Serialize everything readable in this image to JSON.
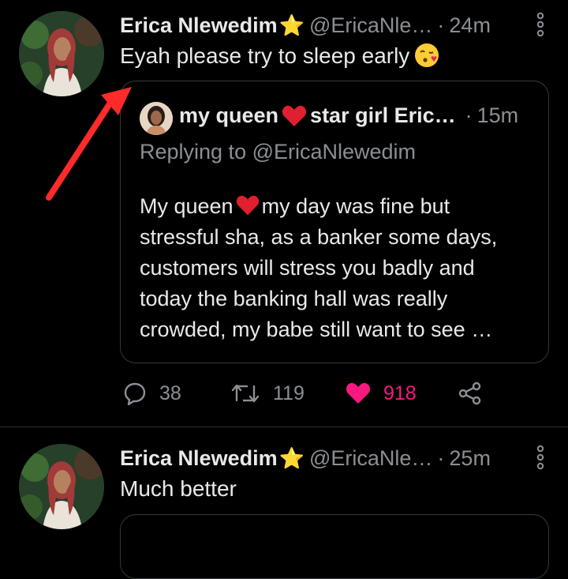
{
  "tweets": [
    {
      "author_name": "Erica Nlewedim",
      "star": "⭐",
      "handle": "@EricaNle…",
      "separator": "·",
      "time": "24m",
      "text": "Eyah please try to sleep early",
      "emoji_icon": "face-blowing-kiss-emoji",
      "quote": {
        "author_name": "my queen",
        "author_name_rest": "star girl Eric…",
        "separator": "·",
        "time": "15m",
        "replying_to": "Replying to @EricaNlewedim",
        "text_first_part": "My queen",
        "text_first_rest": "my day was fine but",
        "lines": [
          "stressful sha, as a banker some days,",
          "customers will stress you badly and",
          "today the banking hall was really",
          "crowded, my babe still want to see …"
        ]
      },
      "actions": {
        "replies": "38",
        "retweets": "119",
        "likes": "918"
      }
    },
    {
      "author_name": "Erica Nlewedim",
      "star": "⭐",
      "handle": "@EricaNle…",
      "separator": "·",
      "time": "25m",
      "text": "Much better"
    }
  ],
  "colors": {
    "background": "#000000",
    "text": "#e7e9ea",
    "secondary_text": "#8b8f94",
    "like": "#f91880",
    "star": "#f6c02f",
    "annotation_arrow": "#ff2a2a"
  }
}
